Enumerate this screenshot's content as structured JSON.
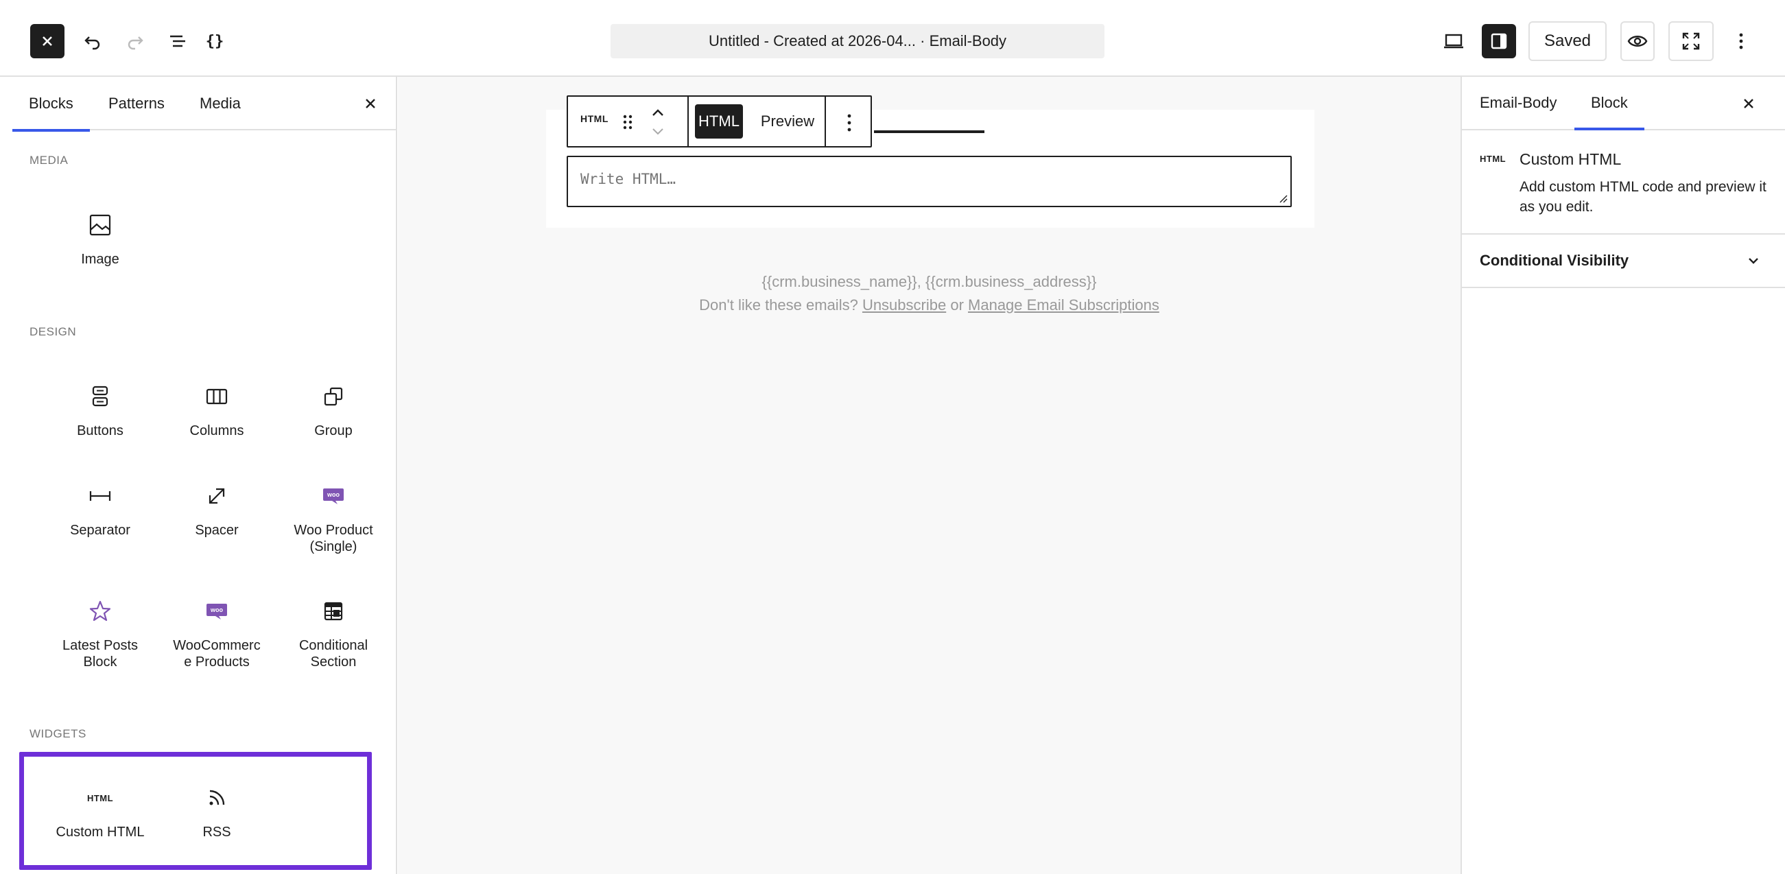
{
  "header": {
    "document_title": "Untitled - Created at 2026-04... · Email-Body",
    "saved_label": "Saved"
  },
  "inserter": {
    "tabs": [
      {
        "label": "Blocks",
        "active": true
      },
      {
        "label": "Patterns",
        "active": false
      },
      {
        "label": "Media",
        "active": false
      }
    ],
    "categories": {
      "media": {
        "title": "MEDIA",
        "blocks": [
          {
            "label": "Image",
            "icon": "image-icon"
          }
        ]
      },
      "design": {
        "title": "DESIGN",
        "blocks": [
          {
            "label": "Buttons",
            "icon": "buttons-icon"
          },
          {
            "label": "Columns",
            "icon": "columns-icon"
          },
          {
            "label": "Group",
            "icon": "group-icon"
          },
          {
            "label": "Separator",
            "icon": "separator-icon"
          },
          {
            "label": "Spacer",
            "icon": "spacer-icon"
          },
          {
            "label": "Woo Product (Single)",
            "icon": "woo-icon"
          },
          {
            "label": "Latest Posts Block",
            "icon": "star-icon"
          },
          {
            "label": "WooCommerce Products",
            "icon": "woo-icon"
          },
          {
            "label": "Conditional Section",
            "icon": "table-icon"
          }
        ]
      },
      "widgets": {
        "title": "WIDGETS",
        "blocks": [
          {
            "label": "Custom HTML",
            "icon": "html-icon",
            "icon_text": "HTML"
          },
          {
            "label": "RSS",
            "icon": "rss-icon"
          }
        ]
      }
    },
    "woo_badge": "woo"
  },
  "canvas": {
    "block_toolbar": {
      "block_icon_text": "HTML",
      "mode_html": "HTML",
      "mode_preview": "Preview"
    },
    "html_input_placeholder": "Write HTML…",
    "footer": {
      "line1": "{{crm.business_name}}, {{crm.business_address}}",
      "line2_prefix": "Don't like these emails? ",
      "unsubscribe": "Unsubscribe",
      "or": " or ",
      "manage": "Manage Email Subscriptions"
    }
  },
  "settings": {
    "tabs": [
      {
        "label": "Email-Body",
        "active": false
      },
      {
        "label": "Block",
        "active": true
      }
    ],
    "block_card": {
      "icon_text": "HTML",
      "title": "Custom HTML",
      "description": "Add custom HTML code and preview it as you edit."
    },
    "conditional_visibility": "Conditional Visibility"
  },
  "colors": {
    "accent": "#3858e9",
    "highlight": "#6e2fd8",
    "woo": "#7f54b3",
    "dark": "#1e1e1e"
  }
}
